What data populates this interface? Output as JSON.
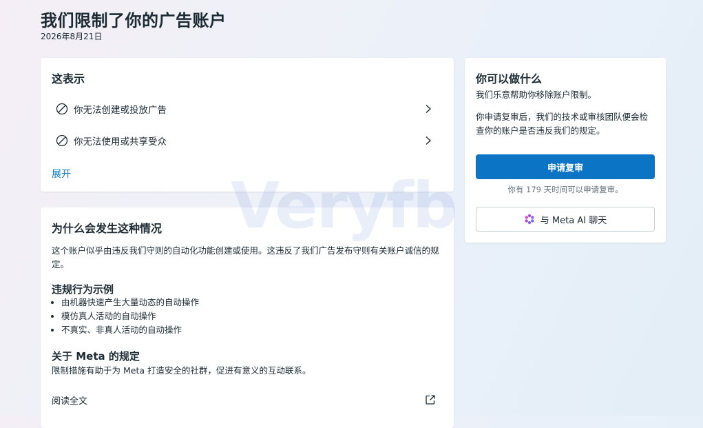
{
  "header": {
    "title": "我们限制了你的广告账户",
    "date": "2026年8月21日"
  },
  "meaning_card": {
    "heading": "这表示",
    "restrictions": [
      {
        "label": "你无法创建或投放广告",
        "icon": "ban-icon"
      },
      {
        "label": "你无法使用或共享受众",
        "icon": "ban-icon"
      }
    ],
    "expand_label": "展开"
  },
  "why_card": {
    "heading": "为什么会发生这种情况",
    "description": "这个账户似乎由违反我们守则的自动化功能创建或使用。这违反了我们广告发布守则有关账户诚信的规定。",
    "examples_heading": "违规行为示例",
    "examples": [
      "由机器快速产生大量动态的自动操作",
      "模仿真人活动的自动操作",
      "不真实、非真人活动的自动操作"
    ],
    "policy_heading": "关于 Meta 的规定",
    "policy_text": "限制措施有助于为 Meta 打造安全的社群，促进有意义的互动联系。",
    "read_label": "阅读全文"
  },
  "actions_card": {
    "heading": "你可以做什么",
    "help_text_1": "我们乐意帮助你移除账户限制。",
    "help_text_2": "你申请复审后，我们的技术或审核团队便会检查你的账户是否违反我们的规定。",
    "appeal_button_label": "申请复审",
    "days_remaining_text": "你有 179 天时间可以申请复审。",
    "ai_button_label": "与 Meta AI 聊天"
  },
  "watermark": "Veryfb",
  "colors": {
    "accent": "#0b74c4",
    "link": "#0a7cc4",
    "text": "#1c2b33",
    "muted": "#65727a"
  }
}
